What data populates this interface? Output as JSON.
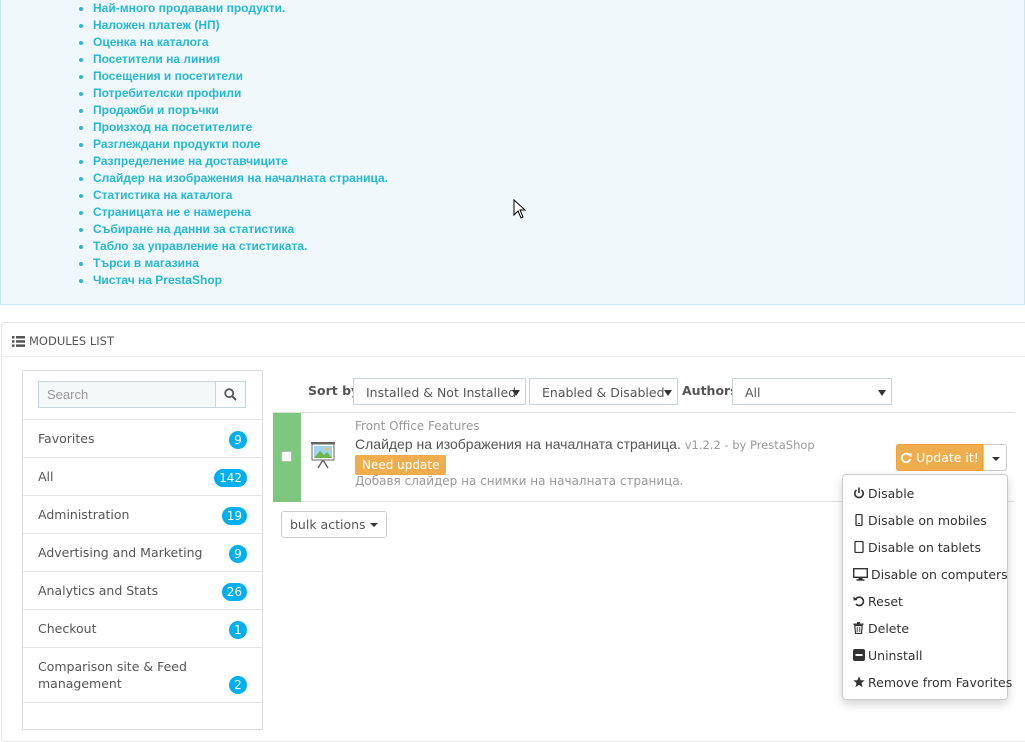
{
  "info_links": [
    "Най-много продавани продукти.",
    "Наложен платеж (НП)",
    "Оценка на каталога",
    "Посетители на линия",
    "Посещения и посетители",
    "Потребителски профили",
    "Продажби и поръчки",
    "Произход на посетителите",
    "Разглеждани продукти поле",
    "Разпределение на доставчиците",
    "Слайдер на изображения на началната страница.",
    "Статистика на каталога",
    "Страницата не е намерена",
    "Събиране на данни за статистика",
    "Табло за управление на стистиката.",
    "Търси в магазина",
    "Чистач на PrestaShop"
  ],
  "modules_panel": {
    "heading": "MODULES LIST"
  },
  "sidebar": {
    "search_placeholder": "Search",
    "categories": [
      {
        "label": "Favorites",
        "count": "9"
      },
      {
        "label": "All",
        "count": "142"
      },
      {
        "label": "Administration",
        "count": "19"
      },
      {
        "label": "Advertising and Marketing",
        "count": "9"
      },
      {
        "label": "Analytics and Stats",
        "count": "26"
      },
      {
        "label": "Checkout",
        "count": "1"
      },
      {
        "label": "Comparison site & Feed management",
        "count": "2"
      }
    ]
  },
  "toolbar": {
    "sort_by_label": "Sort by",
    "install_filter": "Installed & Not Installed",
    "enabled_filter": "Enabled & Disabled",
    "authors_label": "Authors",
    "authors_filter": "All"
  },
  "module": {
    "category": "Front Office Features",
    "name": "Слайдер на изображения на началната страница.",
    "version": "v1.2.2 - by PrestaShop",
    "badge": "Need update",
    "description": "Добавя слайдер на снимки на началната страница.",
    "update_label": "Update it!"
  },
  "bulk_actions_label": "bulk actions",
  "dropdown": [
    {
      "icon": "power-icon",
      "label": "Disable"
    },
    {
      "icon": "mobile-icon",
      "label": "Disable on mobiles"
    },
    {
      "icon": "tablet-icon",
      "label": "Disable on tablets"
    },
    {
      "icon": "desktop-icon",
      "label": "Disable on computers"
    },
    {
      "icon": "undo-icon",
      "label": "Reset"
    },
    {
      "icon": "trash-icon",
      "label": "Delete"
    },
    {
      "icon": "minus-square-icon",
      "label": "Uninstall"
    },
    {
      "icon": "star-icon",
      "label": "Remove from Favorites"
    }
  ],
  "colors": {
    "link": "#25b9d7",
    "badge": "#00aff0",
    "warning": "#f0ad4e",
    "enabled": "#7ec77e"
  }
}
